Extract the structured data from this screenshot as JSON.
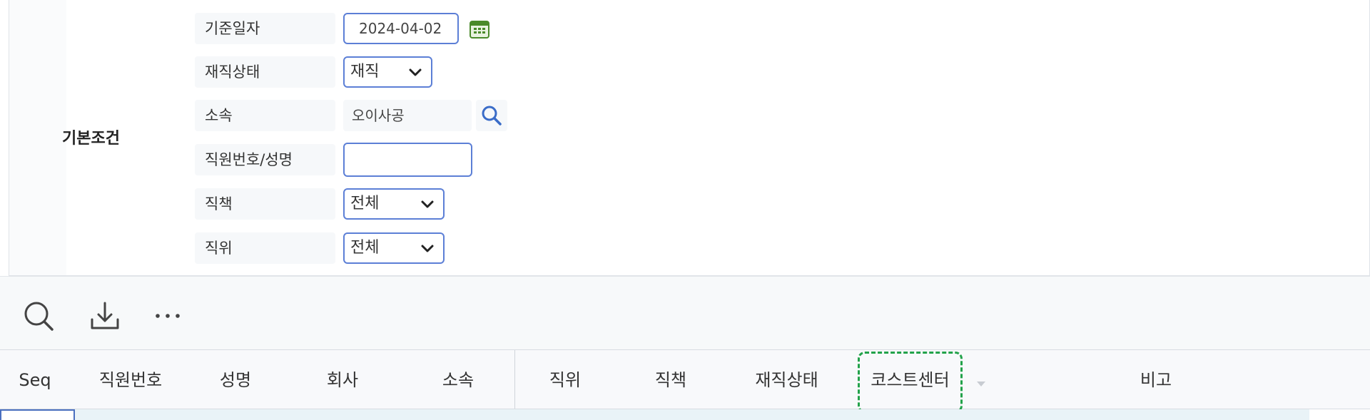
{
  "filters": {
    "section_label": "기본조건",
    "base_date": {
      "label": "기준일자",
      "value": "2024-04-02"
    },
    "employment_status": {
      "label": "재직상태",
      "value": "재직"
    },
    "department": {
      "label": "소속",
      "value": "오이사공"
    },
    "employee": {
      "label": "직원번호/성명",
      "value": ""
    },
    "duty": {
      "label": "직책",
      "value": "전체"
    },
    "position": {
      "label": "직위",
      "value": "전체"
    }
  },
  "toolbar": {
    "icons": [
      "search-icon",
      "download-icon",
      "more-icon"
    ]
  },
  "grid": {
    "columns": [
      "Seq",
      "직원번호",
      "성명",
      "회사",
      "소속",
      "직위",
      "직책",
      "재직상태",
      "코스트센터",
      "비고"
    ]
  },
  "colors": {
    "input_border": "#5c7fd6",
    "highlight": "#22a24a",
    "calendar_icon": "#4a8a2a"
  }
}
